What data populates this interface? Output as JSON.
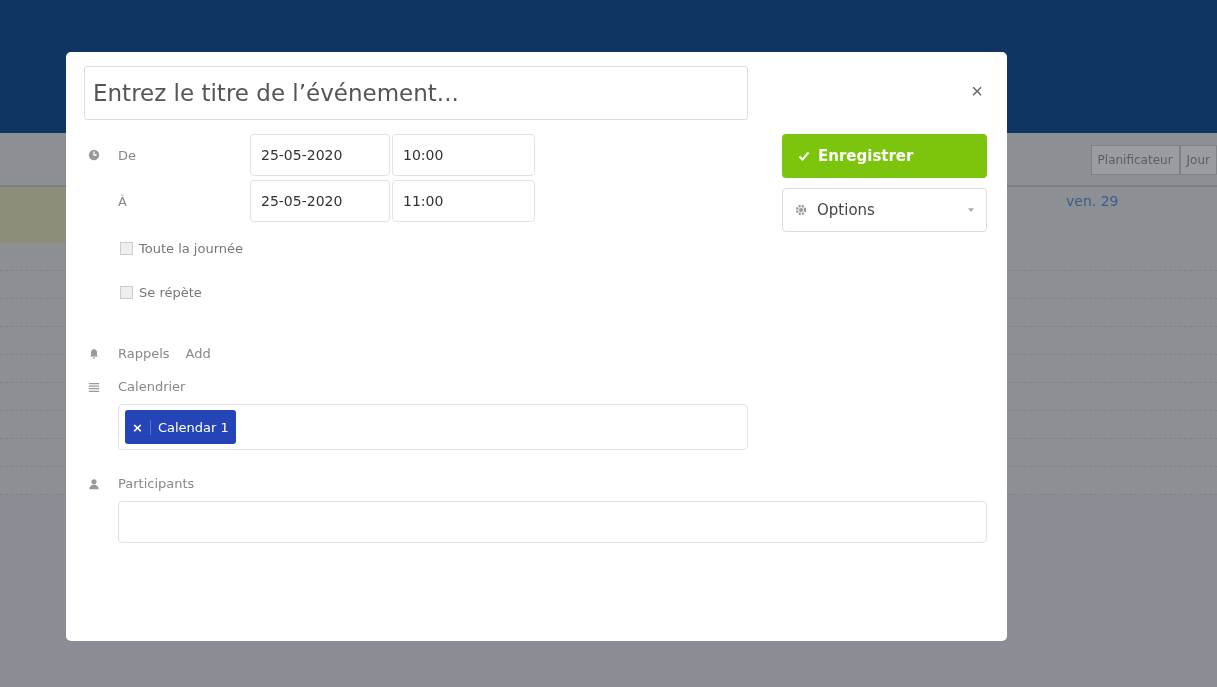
{
  "background": {
    "view_buttons": [
      {
        "label": "Planificateur",
        "selected": false
      },
      {
        "label": "Jour",
        "selected": false
      }
    ],
    "day_header": "ven. 29"
  },
  "dialog": {
    "title_field": {
      "placeholder": "Entrez le titre de l’événement..."
    },
    "from": {
      "label": "De",
      "date": "25-05-2020",
      "time": "10:00"
    },
    "to": {
      "label": "À",
      "date": "25-05-2020",
      "time": "11:00"
    },
    "options": [
      {
        "label": "Toute la journée",
        "checked": false
      },
      {
        "label": "Se répète",
        "checked": false
      }
    ],
    "reminders": {
      "label": "Rappels",
      "action": "Add"
    },
    "calendar": {
      "label": "Calendrier",
      "tags": [
        "Calendar 1"
      ]
    },
    "participants": {
      "label": "Participants"
    },
    "save_button": "Enregistrer",
    "options_button": "Options",
    "close": "×"
  }
}
